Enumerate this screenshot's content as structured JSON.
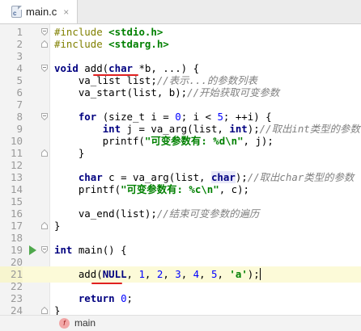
{
  "tab": {
    "title": "main.c",
    "icon": "c-file-icon",
    "close": "×"
  },
  "lines": [
    {
      "n": "1"
    },
    {
      "n": "2"
    },
    {
      "n": "3"
    },
    {
      "n": "4"
    },
    {
      "n": "5"
    },
    {
      "n": "6"
    },
    {
      "n": "7"
    },
    {
      "n": "8"
    },
    {
      "n": "9"
    },
    {
      "n": "10"
    },
    {
      "n": "11"
    },
    {
      "n": "12"
    },
    {
      "n": "13"
    },
    {
      "n": "14"
    },
    {
      "n": "15"
    },
    {
      "n": "16"
    },
    {
      "n": "17"
    },
    {
      "n": "18"
    },
    {
      "n": "19"
    },
    {
      "n": "20"
    },
    {
      "n": "21"
    },
    {
      "n": "22"
    },
    {
      "n": "23"
    },
    {
      "n": "24"
    }
  ],
  "code": {
    "l1_a": "#include ",
    "l1_b": "<stdio.h>",
    "l2_a": "#include ",
    "l2_b": "<stdarg.h>",
    "l4_a": "void",
    "l4_b": " add(",
    "l4_c": "char",
    "l4_d": " *b, ...) {",
    "l5_a": "    va_list list;",
    "l5_b": "//表示...的参数列表",
    "l6_a": "    va_start(list, b);",
    "l6_b": "//开始获取可变参数",
    "l8_a": "    ",
    "l8_b": "for",
    "l8_c": " (size_t i = ",
    "l8_d": "0",
    "l8_e": "; i < ",
    "l8_f": "5",
    "l8_g": "; ++i) {",
    "l9_a": "        ",
    "l9_b": "int",
    "l9_c": " j = va_arg(list, ",
    "l9_d": "int",
    "l9_e": ");",
    "l9_f": "//取出int类型的参数",
    "l10_a": "        printf(",
    "l10_b": "\"可变参数有: %d\\n\"",
    "l10_c": ", j);",
    "l11_a": "    }",
    "l13_a": "    ",
    "l13_b": "char",
    "l13_c": " c = va_arg(list, ",
    "l13_d": "char",
    "l13_e": ");",
    "l13_f": "//取出char类型的参数",
    "l14_a": "    printf(",
    "l14_b": "\"可变参数有: %c\\n\"",
    "l14_c": ", c);",
    "l16_a": "    va_end(list);",
    "l16_b": "//结束可变参数的遍历",
    "l17_a": "}",
    "l19_a": "int",
    "l19_b": " main() {",
    "l21_a": "    add(",
    "l21_b": "NULL",
    "l21_c": ", ",
    "l21_d": "1",
    "l21_e": ", ",
    "l21_f": "2",
    "l21_g": ", ",
    "l21_h": "3",
    "l21_i": ", ",
    "l21_j": "4",
    "l21_k": ", ",
    "l21_l": "5",
    "l21_m": ", ",
    "l21_n": "'a'",
    "l21_o": ");",
    "l23_a": "    ",
    "l23_b": "return",
    "l23_c": " ",
    "l23_d": "0",
    "l23_e": ";",
    "l24_a": "}"
  },
  "bottom": {
    "badge": "f",
    "function_name": "main"
  },
  "colors": {
    "keyword": "#000080",
    "string": "#008000",
    "number": "#0000ff",
    "comment": "#808080",
    "current_line": "#fcfad8",
    "underline": "#e02020",
    "run": "#4fa84c"
  }
}
